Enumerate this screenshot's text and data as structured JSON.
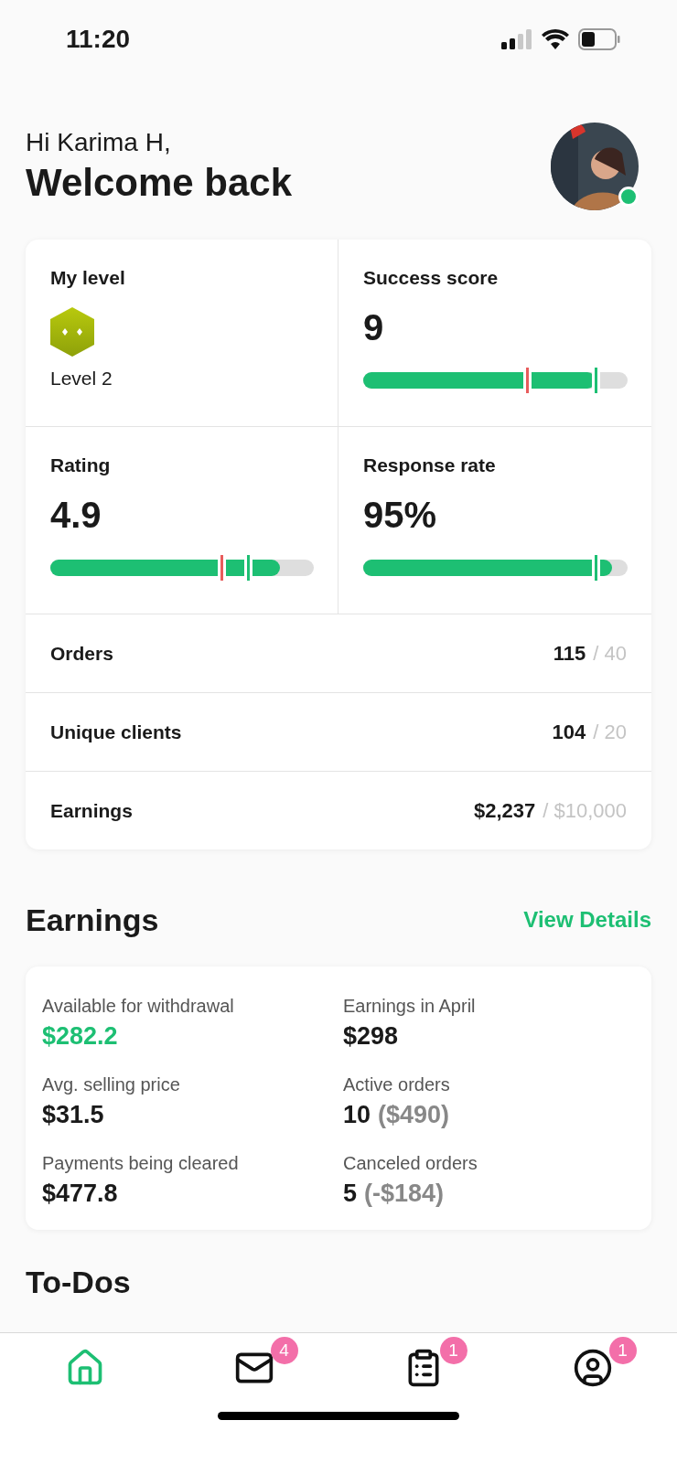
{
  "status_bar": {
    "time": "11:20"
  },
  "header": {
    "greeting": "Hi Karima H,",
    "title": "Welcome back",
    "avatar": {
      "kind": "picture",
      "online": true
    }
  },
  "metrics": [
    {
      "kind": "badge",
      "label": "My level",
      "value": "Level 2"
    },
    {
      "kind": "bar",
      "label": "Success score",
      "value": "9",
      "level": 0.88
    },
    {
      "kind": "bar",
      "label": "Rating",
      "value": "4.9",
      "level": 0.87
    },
    {
      "kind": "bar",
      "label": "Response rate",
      "value": "95%",
      "level": 0.94
    }
  ],
  "stats": [
    {
      "label": "Orders",
      "value": "115",
      "target": "/ 40"
    },
    {
      "label": "Unique clients",
      "value": "104",
      "target": "/ 20"
    },
    {
      "label": "Earnings",
      "value": "$2,237",
      "target": "/ $10,000"
    }
  ],
  "earnings": {
    "title": "Earnings",
    "link": "View Details",
    "items": [
      {
        "label": "Available for withdrawal",
        "value": "$282.2",
        "accent": true
      },
      {
        "label": "Earnings in April",
        "value": "$298",
        "accent": false
      },
      {
        "label": "Avg. selling price",
        "value": "$31.5",
        "accent": false
      },
      {
        "label": "Active orders",
        "value": "10",
        "note": "($490)",
        "accent": false
      },
      {
        "label": "Payments being cleared",
        "value": "$477.8",
        "accent": false
      },
      {
        "label": "Canceled orders",
        "value": "5",
        "note": "(-$184)",
        "accent": false
      }
    ]
  },
  "todos": {
    "title": "To-Dos"
  },
  "nav": [
    {
      "selected": true
    },
    {
      "selected": false,
      "badge": "4"
    },
    {
      "selected": false,
      "badge": "1"
    },
    {
      "selected": false,
      "badge": "1"
    }
  ]
}
